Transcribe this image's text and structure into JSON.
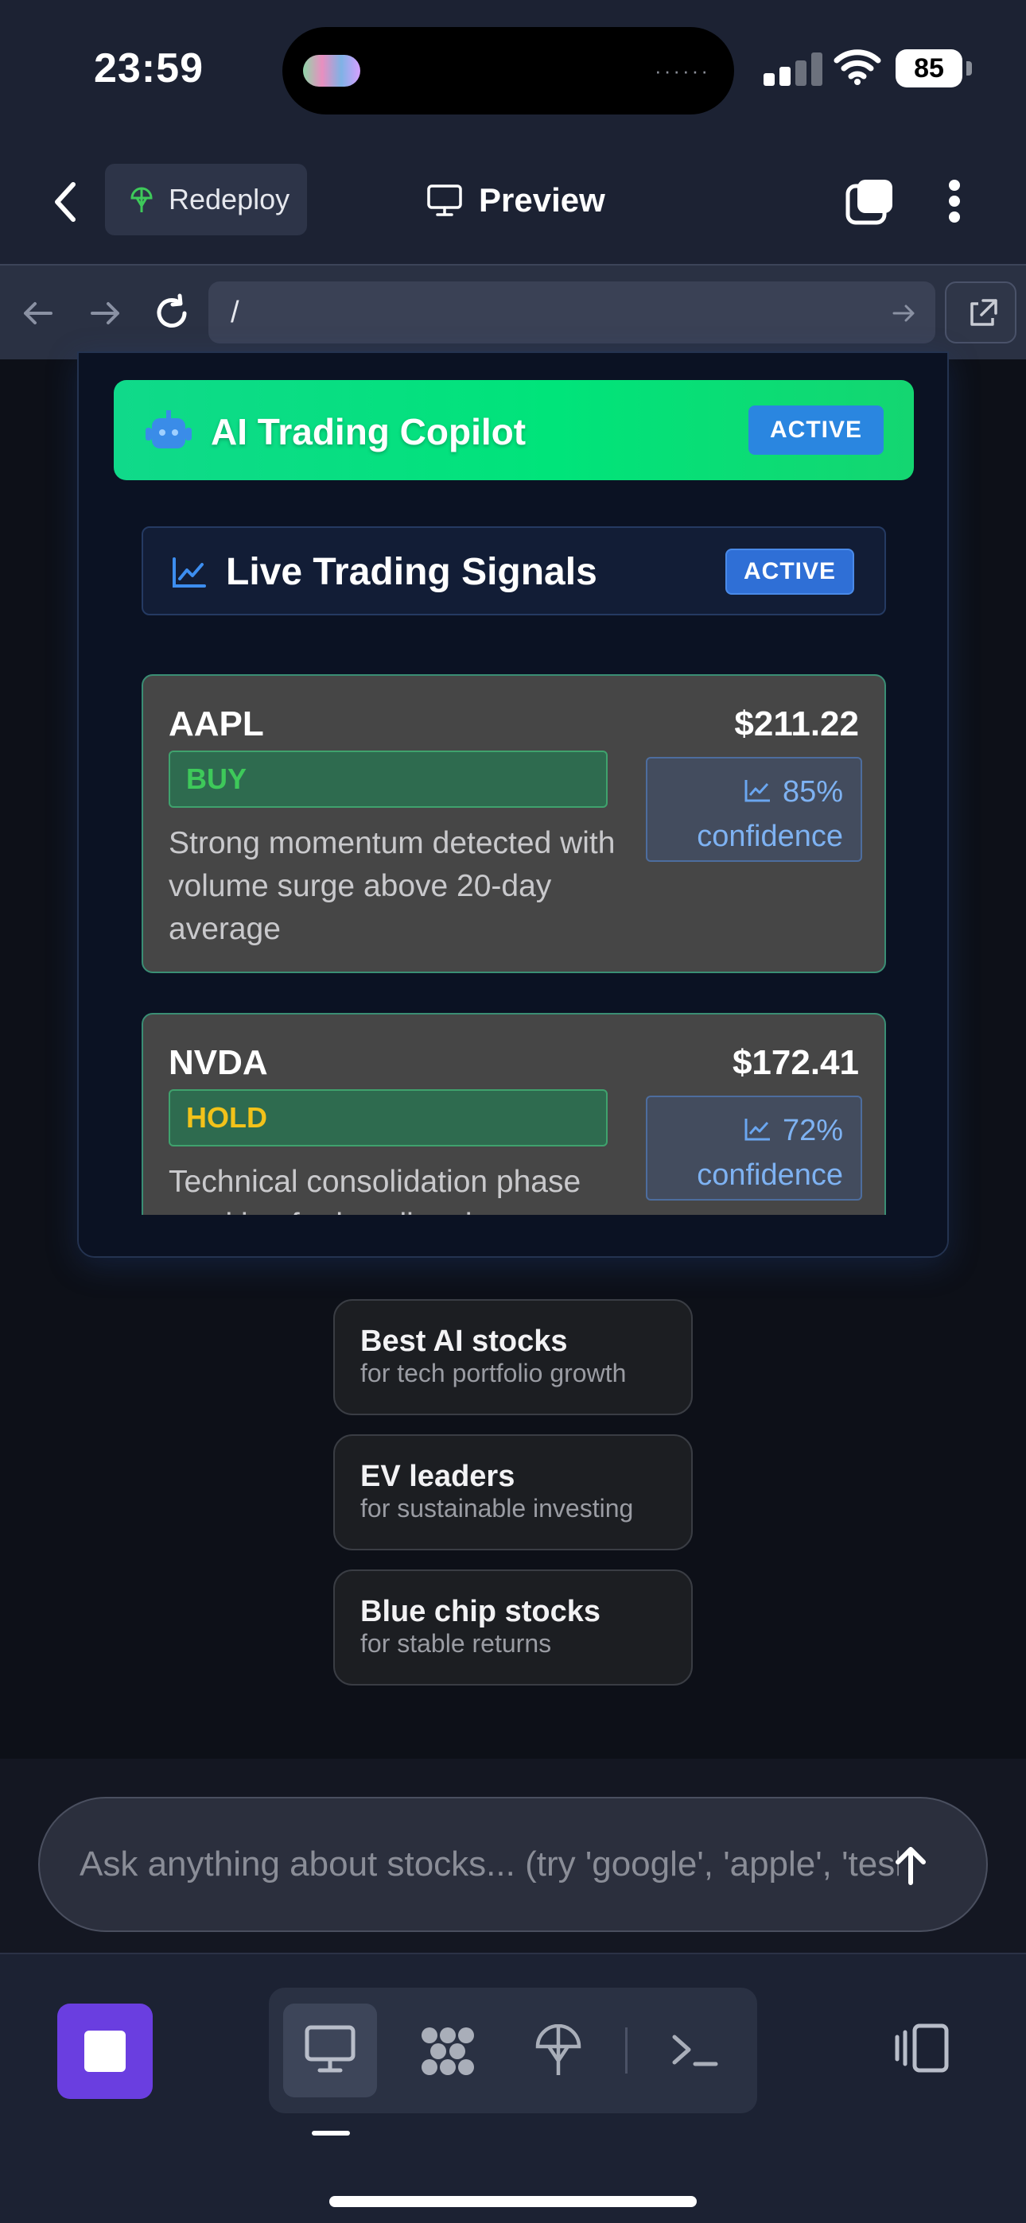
{
  "status_bar": {
    "time": "23:59",
    "battery": "85"
  },
  "nav": {
    "redeploy_label": "Redeploy",
    "preview_label": "Preview"
  },
  "url_bar": {
    "path": "/"
  },
  "copilot": {
    "title": "AI Trading Copilot",
    "badge": "ACTIVE"
  },
  "signals_panel": {
    "title": "Live Trading Signals",
    "badge": "ACTIVE",
    "cards": [
      {
        "ticker": "AAPL",
        "price": "$211.22",
        "action": "BUY",
        "action_color": "#3ec95a",
        "confidence": "85%",
        "confidence_label": "confidence",
        "description": "Strong momentum detected with volume surge above 20-day average"
      },
      {
        "ticker": "NVDA",
        "price": "$172.41",
        "action": "HOLD",
        "action_color": "#f2c21a",
        "confidence": "72%",
        "confidence_label": "confidence",
        "description": "Technical consolidation phase awaiting further direction"
      }
    ]
  },
  "prompts": [
    {
      "title": "Best AI stocks",
      "subtitle": "for tech portfolio growth"
    },
    {
      "title": "EV leaders",
      "subtitle": "for sustainable investing"
    },
    {
      "title": "Blue chip stocks",
      "subtitle": "for stable returns"
    }
  ],
  "chat": {
    "placeholder": "Ask anything about stocks... (try 'google', 'apple', 'tesla')"
  },
  "colors": {
    "accent_green": "#00e47a",
    "accent_blue": "#2a86e0",
    "stop_purple": "#6a3ee0"
  }
}
